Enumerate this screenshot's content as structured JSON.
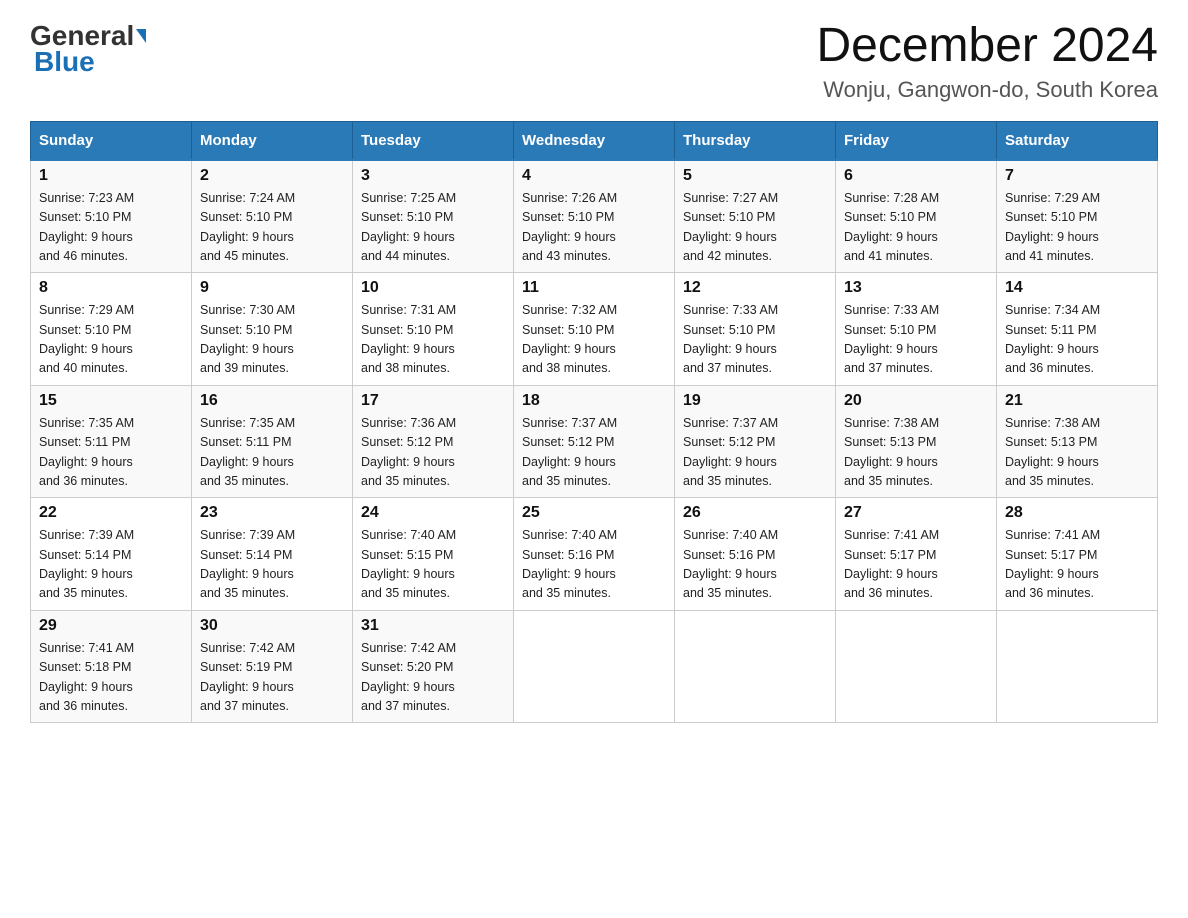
{
  "header": {
    "logo_general": "General",
    "logo_blue": "Blue",
    "title": "December 2024",
    "subtitle": "Wonju, Gangwon-do, South Korea"
  },
  "days_of_week": [
    "Sunday",
    "Monday",
    "Tuesday",
    "Wednesday",
    "Thursday",
    "Friday",
    "Saturday"
  ],
  "weeks": [
    [
      {
        "day": "1",
        "sunrise": "7:23 AM",
        "sunset": "5:10 PM",
        "daylight": "9 hours and 46 minutes."
      },
      {
        "day": "2",
        "sunrise": "7:24 AM",
        "sunset": "5:10 PM",
        "daylight": "9 hours and 45 minutes."
      },
      {
        "day": "3",
        "sunrise": "7:25 AM",
        "sunset": "5:10 PM",
        "daylight": "9 hours and 44 minutes."
      },
      {
        "day": "4",
        "sunrise": "7:26 AM",
        "sunset": "5:10 PM",
        "daylight": "9 hours and 43 minutes."
      },
      {
        "day": "5",
        "sunrise": "7:27 AM",
        "sunset": "5:10 PM",
        "daylight": "9 hours and 42 minutes."
      },
      {
        "day": "6",
        "sunrise": "7:28 AM",
        "sunset": "5:10 PM",
        "daylight": "9 hours and 41 minutes."
      },
      {
        "day": "7",
        "sunrise": "7:29 AM",
        "sunset": "5:10 PM",
        "daylight": "9 hours and 41 minutes."
      }
    ],
    [
      {
        "day": "8",
        "sunrise": "7:29 AM",
        "sunset": "5:10 PM",
        "daylight": "9 hours and 40 minutes."
      },
      {
        "day": "9",
        "sunrise": "7:30 AM",
        "sunset": "5:10 PM",
        "daylight": "9 hours and 39 minutes."
      },
      {
        "day": "10",
        "sunrise": "7:31 AM",
        "sunset": "5:10 PM",
        "daylight": "9 hours and 38 minutes."
      },
      {
        "day": "11",
        "sunrise": "7:32 AM",
        "sunset": "5:10 PM",
        "daylight": "9 hours and 38 minutes."
      },
      {
        "day": "12",
        "sunrise": "7:33 AM",
        "sunset": "5:10 PM",
        "daylight": "9 hours and 37 minutes."
      },
      {
        "day": "13",
        "sunrise": "7:33 AM",
        "sunset": "5:10 PM",
        "daylight": "9 hours and 37 minutes."
      },
      {
        "day": "14",
        "sunrise": "7:34 AM",
        "sunset": "5:11 PM",
        "daylight": "9 hours and 36 minutes."
      }
    ],
    [
      {
        "day": "15",
        "sunrise": "7:35 AM",
        "sunset": "5:11 PM",
        "daylight": "9 hours and 36 minutes."
      },
      {
        "day": "16",
        "sunrise": "7:35 AM",
        "sunset": "5:11 PM",
        "daylight": "9 hours and 35 minutes."
      },
      {
        "day": "17",
        "sunrise": "7:36 AM",
        "sunset": "5:12 PM",
        "daylight": "9 hours and 35 minutes."
      },
      {
        "day": "18",
        "sunrise": "7:37 AM",
        "sunset": "5:12 PM",
        "daylight": "9 hours and 35 minutes."
      },
      {
        "day": "19",
        "sunrise": "7:37 AM",
        "sunset": "5:12 PM",
        "daylight": "9 hours and 35 minutes."
      },
      {
        "day": "20",
        "sunrise": "7:38 AM",
        "sunset": "5:13 PM",
        "daylight": "9 hours and 35 minutes."
      },
      {
        "day": "21",
        "sunrise": "7:38 AM",
        "sunset": "5:13 PM",
        "daylight": "9 hours and 35 minutes."
      }
    ],
    [
      {
        "day": "22",
        "sunrise": "7:39 AM",
        "sunset": "5:14 PM",
        "daylight": "9 hours and 35 minutes."
      },
      {
        "day": "23",
        "sunrise": "7:39 AM",
        "sunset": "5:14 PM",
        "daylight": "9 hours and 35 minutes."
      },
      {
        "day": "24",
        "sunrise": "7:40 AM",
        "sunset": "5:15 PM",
        "daylight": "9 hours and 35 minutes."
      },
      {
        "day": "25",
        "sunrise": "7:40 AM",
        "sunset": "5:16 PM",
        "daylight": "9 hours and 35 minutes."
      },
      {
        "day": "26",
        "sunrise": "7:40 AM",
        "sunset": "5:16 PM",
        "daylight": "9 hours and 35 minutes."
      },
      {
        "day": "27",
        "sunrise": "7:41 AM",
        "sunset": "5:17 PM",
        "daylight": "9 hours and 36 minutes."
      },
      {
        "day": "28",
        "sunrise": "7:41 AM",
        "sunset": "5:17 PM",
        "daylight": "9 hours and 36 minutes."
      }
    ],
    [
      {
        "day": "29",
        "sunrise": "7:41 AM",
        "sunset": "5:18 PM",
        "daylight": "9 hours and 36 minutes."
      },
      {
        "day": "30",
        "sunrise": "7:42 AM",
        "sunset": "5:19 PM",
        "daylight": "9 hours and 37 minutes."
      },
      {
        "day": "31",
        "sunrise": "7:42 AM",
        "sunset": "5:20 PM",
        "daylight": "9 hours and 37 minutes."
      },
      null,
      null,
      null,
      null
    ]
  ],
  "labels": {
    "sunrise": "Sunrise:",
    "sunset": "Sunset:",
    "daylight": "Daylight:"
  }
}
